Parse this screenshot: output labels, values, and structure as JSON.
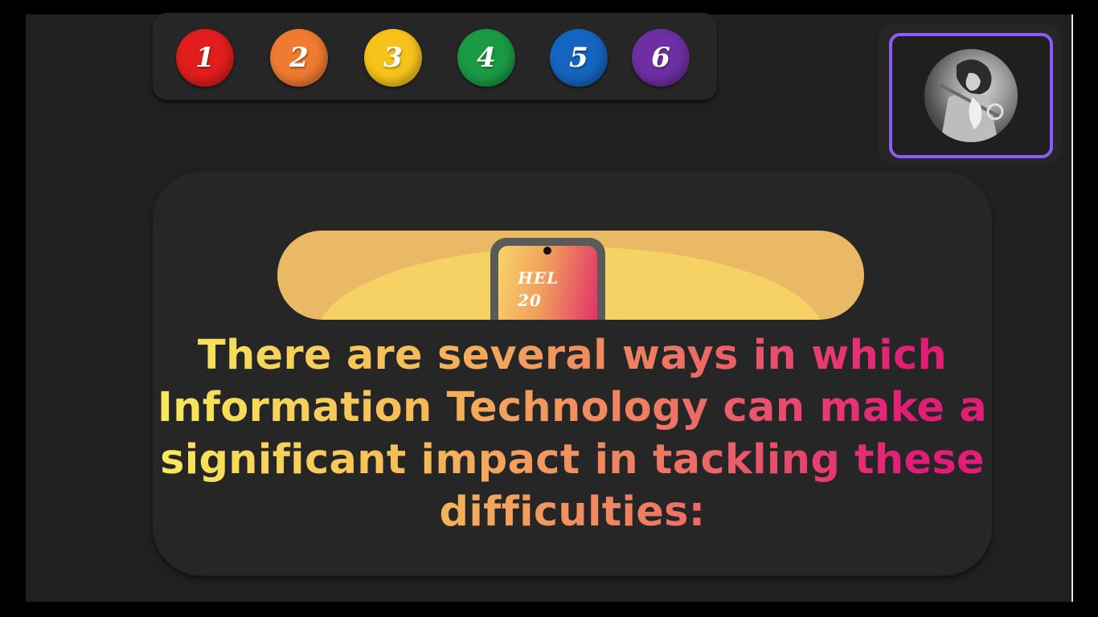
{
  "navigation": {
    "items": [
      {
        "label": "1",
        "color": "#e11d1d"
      },
      {
        "label": "2",
        "color": "#ee7b30"
      },
      {
        "label": "3",
        "color": "#f7c21a"
      },
      {
        "label": "4",
        "color": "#1a9a45"
      },
      {
        "label": "5",
        "color": "#1565c0"
      },
      {
        "label": "6",
        "color": "#6d2fa3"
      }
    ]
  },
  "profile": {
    "avatar_icon": "avatar-portrait-icon",
    "frame_color": "#8b5cf6"
  },
  "banner": {
    "phone_line1": "HEL",
    "phone_line2": "20",
    "colors": {
      "banner": "#eab965",
      "glow": "#f6d164"
    }
  },
  "headline": {
    "text": "There are several ways in which Information Technology can make a significant impact in tackling these difficulties:",
    "gradient": [
      "#f7ea5c",
      "#f5bd58",
      "#ee7a62",
      "#e21d78"
    ]
  }
}
